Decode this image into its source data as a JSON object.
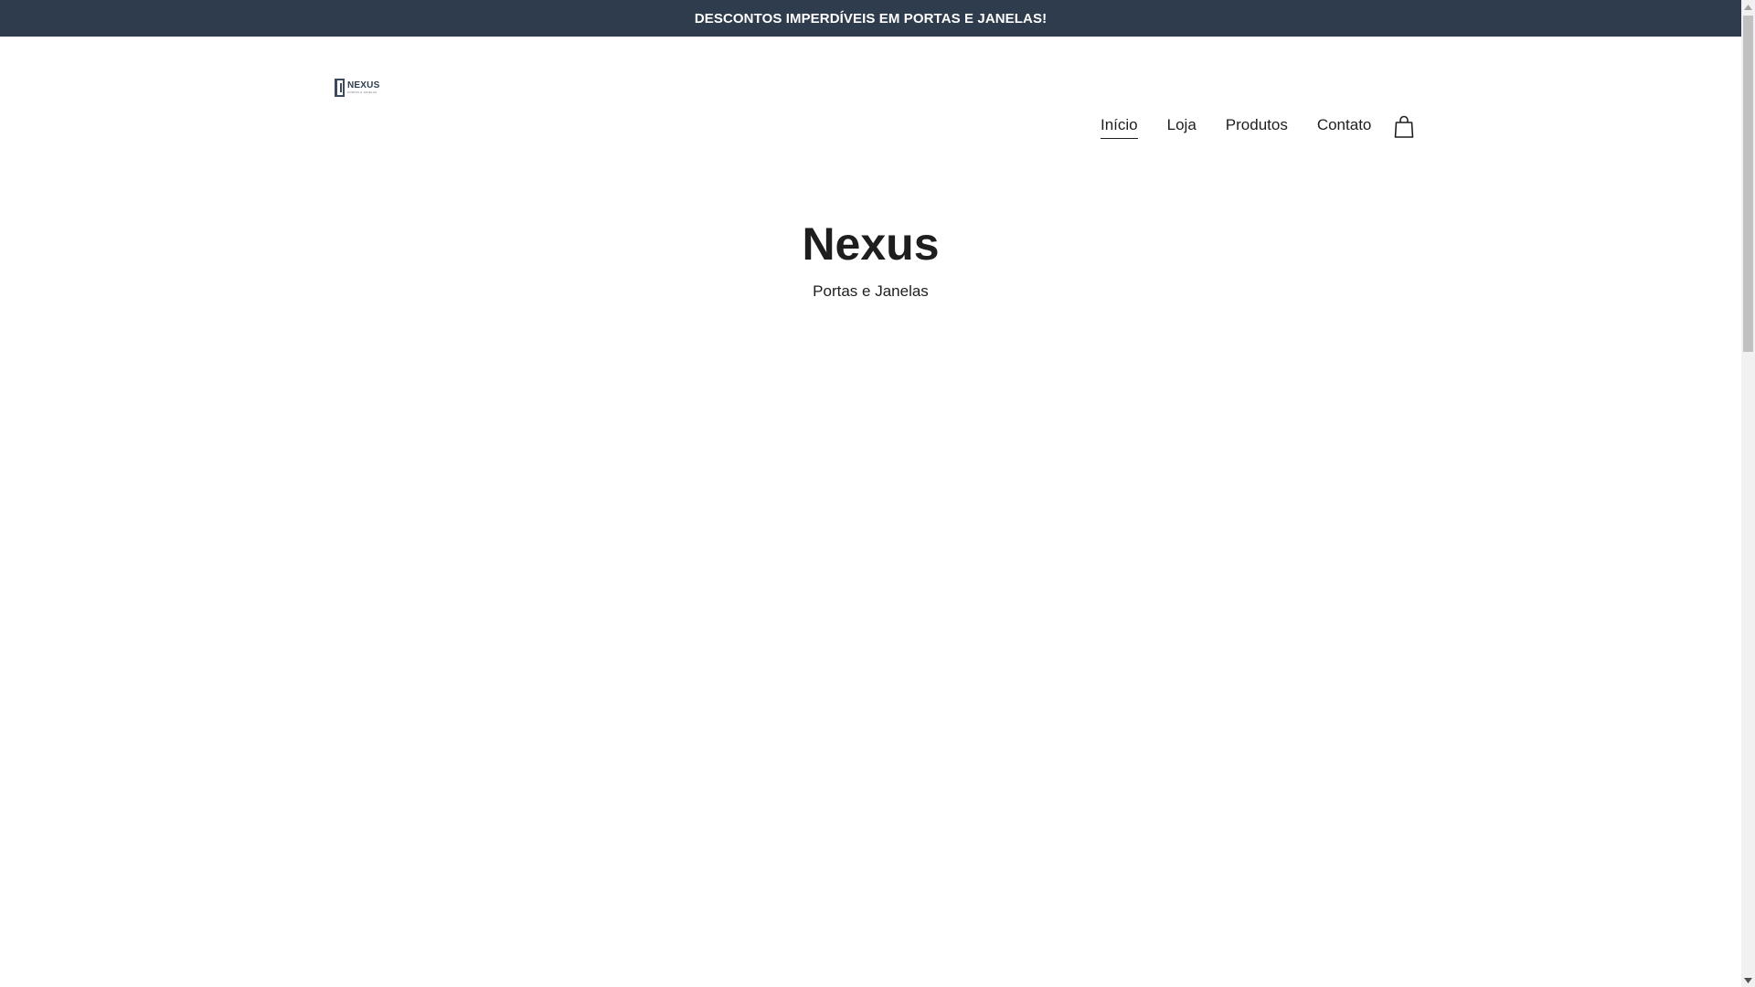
{
  "announcement": {
    "text": "DESCONTOS IMPERDÍVEIS EM PORTAS E JANELAS!"
  },
  "header": {
    "logo": {
      "name": "NEXUS",
      "tagline": "PORTAS E JANELAS"
    },
    "nav": [
      {
        "label": "Início",
        "active": true
      },
      {
        "label": "Loja",
        "active": false
      },
      {
        "label": "Produtos",
        "active": false
      },
      {
        "label": "Contato",
        "active": false
      }
    ],
    "cart_icon": "shopping-bag-icon"
  },
  "hero": {
    "title": "Nexus",
    "subtitle": "Portas e Janelas"
  },
  "colors": {
    "announcement_bg": "#2e3c4d",
    "text": "#1e1e1e",
    "background": "#ffffff"
  }
}
